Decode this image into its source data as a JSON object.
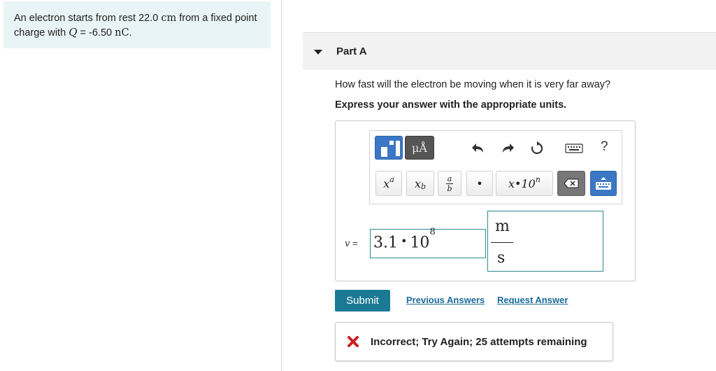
{
  "problem": {
    "text_before": "An electron starts from rest 22.0",
    "dist_unit": "cm",
    "text_mid": "from a fixed point charge with",
    "q_symbol": "Q",
    "q_value": "= -6.50",
    "q_unit": "nC",
    "text_end": "."
  },
  "part": {
    "title": "Part A",
    "question": "How fast will the electron be moving when it is very far away?",
    "instruction": "Express your answer with the appropriate units."
  },
  "toolbar": {
    "units_label": "μÅ",
    "help_label": "?",
    "keys": {
      "superscript": "x",
      "superscript_sup": "a",
      "subscript": "x",
      "subscript_sub": "b",
      "frac_num": "a",
      "frac_den": "b",
      "bullet": "•",
      "sci_base": "x•10",
      "sci_exp": "n"
    }
  },
  "answer": {
    "var_symbol": "v",
    "var_equals": "=",
    "mantissa": "3.1",
    "bullet": "•",
    "base": "10",
    "exponent": "8",
    "unit_numerator": "m",
    "unit_denominator": "s"
  },
  "actions": {
    "submit_label": "Submit",
    "previous_answers": "Previous Answers",
    "request_answer": "Request Answer"
  },
  "feedback": {
    "message": "Incorrect; Try Again; 25 attempts remaining",
    "status_color": "#cc2222"
  },
  "colors": {
    "problem_bg": "#e8f4f5",
    "accent": "#1a7a96",
    "template_blue": "#3b77c4",
    "input_border": "#2b8a8e"
  }
}
